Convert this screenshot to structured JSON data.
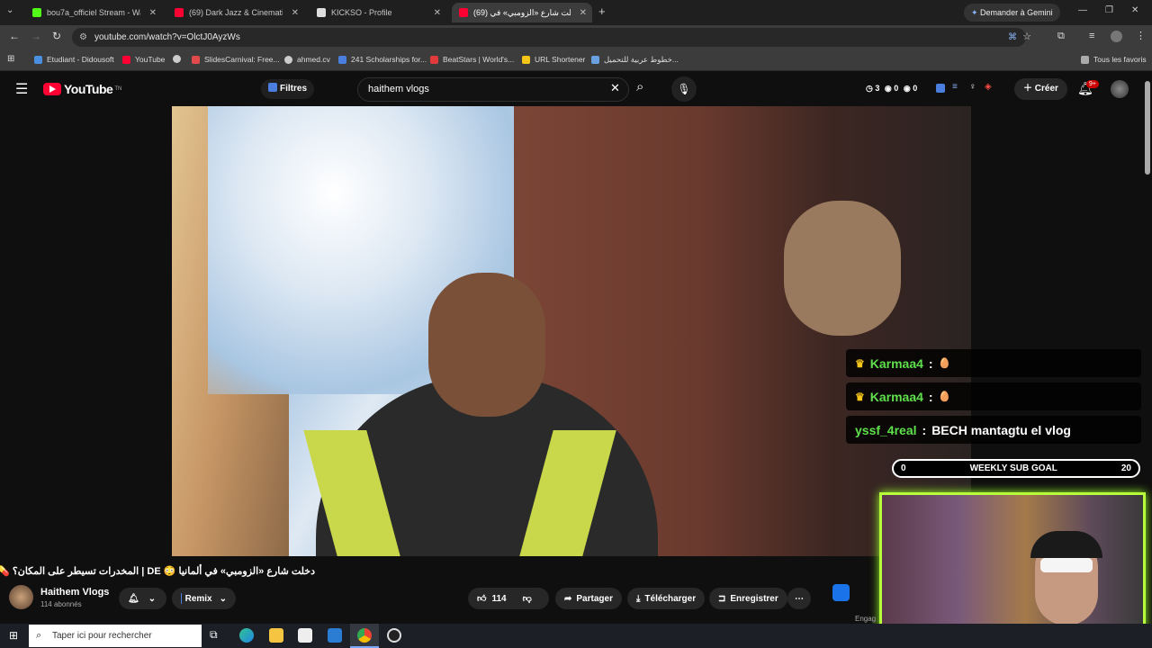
{
  "browser": {
    "tabs": [
      {
        "label": "bou7a_officiel Stream - Watch L",
        "color": "#53fc18",
        "active": false
      },
      {
        "label": "(69) Dark Jazz & Cinematic Trip",
        "color": "#ff0033",
        "active": false
      },
      {
        "label": "KICKSO - Profile",
        "color": "#ffffff",
        "active": false
      },
      {
        "label": "(69) دخلت شارع «الزومبي» في",
        "color": "#ff0033",
        "active": true
      }
    ],
    "gemini_label": "Demander à Gemini",
    "url": "youtube.com/watch?v=OlctJ0AyzWs",
    "bookmarks": [
      {
        "label": "Etudiant - Didousoft",
        "color": "#4a8fe0"
      },
      {
        "label": "YouTube",
        "color": "#ff0033"
      },
      {
        "label": "",
        "color": "#cccccc"
      },
      {
        "label": "SlidesCarnival: Free...",
        "color": "#e04a4a"
      },
      {
        "label": "ahmed.cv",
        "color": "#cccccc"
      },
      {
        "label": "241 Scholarships for...",
        "color": "#4a7fe0"
      },
      {
        "label": "BeatStars | World's...",
        "color": "#e03a3a"
      },
      {
        "label": "URL Shortener",
        "color": "#f5c518"
      },
      {
        "label": "خطوط عربية للتحميل...",
        "color": "#6aa0e0"
      }
    ],
    "all_favorites": "Tous les favoris"
  },
  "youtube": {
    "logo": "YouTube",
    "logo_sup": "TN",
    "filters_label": "Filtres",
    "search_value": "haithem vlogs",
    "stats": [
      "3",
      "0",
      "0"
    ],
    "create_label": "Créer",
    "notif_badge": "9+"
  },
  "chat": [
    {
      "user": "Karmaa4",
      "sep": ":",
      "msg": "",
      "crown": true
    },
    {
      "user": "Karmaa4",
      "sep": ":",
      "msg": "",
      "crown": true
    },
    {
      "user": "yssf_4real",
      "sep": ":",
      "msg": "BECH mantagtu el vlog",
      "crown": false
    }
  ],
  "goal": {
    "start": "0",
    "label": "WEEKLY SUB GOAL",
    "end": "20"
  },
  "video_info": {
    "title": "دخلت شارع «الزومبي» في ألمانيا 😳 DE | المخدرات تسيطر على المكان؟ 💊",
    "channel": "Haithem Vlogs",
    "subs": "114 abonnés",
    "remix": "Remix",
    "likes": "114",
    "share": "Partager",
    "download": "Télécharger",
    "save": "Enregistrer",
    "engage": "Engag"
  },
  "taskbar": {
    "search_placeholder": "Taper ici pour rechercher"
  }
}
